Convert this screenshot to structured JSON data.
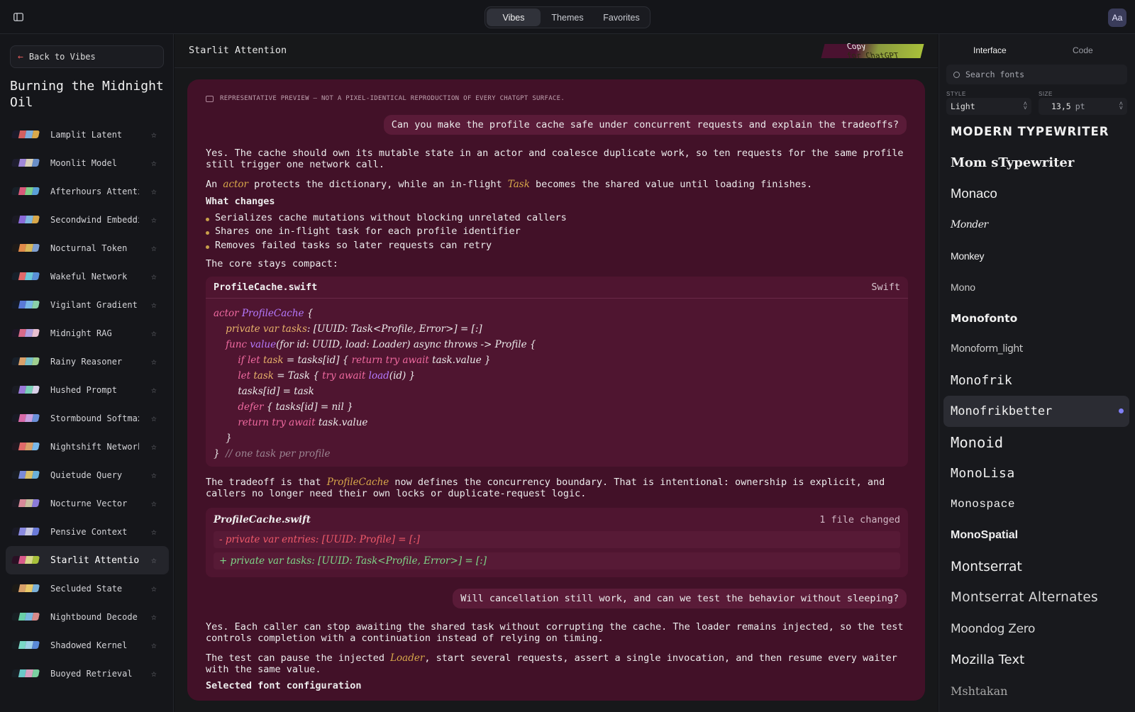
{
  "topbar": {
    "tabs": [
      {
        "label": "Vibes",
        "active": true
      },
      {
        "label": "Themes",
        "active": false
      },
      {
        "label": "Favorites",
        "active": false
      }
    ],
    "font_button": "Aa"
  },
  "left": {
    "back_label": "Back to Vibes",
    "title": "Burning the Midnight Oil",
    "vibes": [
      {
        "name": "Lamplit Latent",
        "colors": [
          "#1a1a2a",
          "#d46060",
          "#7faedc",
          "#d8a84a"
        ]
      },
      {
        "name": "Moonlit Model",
        "colors": [
          "#1e1d2e",
          "#a088d8",
          "#d8d0b8",
          "#6a8fc8"
        ]
      },
      {
        "name": "Afterhours Attenti…",
        "colors": [
          "#182028",
          "#d85a7a",
          "#7fd08a",
          "#5aa0d8"
        ]
      },
      {
        "name": "Secondwind Embeddi…",
        "colors": [
          "#1b1a24",
          "#8a6ad8",
          "#7fb8e0",
          "#d8a84a"
        ]
      },
      {
        "name": "Nocturnal Token",
        "colors": [
          "#1d1a18",
          "#e08a4a",
          "#d8b85a",
          "#7f9fd0"
        ]
      },
      {
        "name": "Wakeful Network",
        "colors": [
          "#16202a",
          "#e06a6a",
          "#6ac8d8",
          "#5a90d8"
        ]
      },
      {
        "name": "Vigilant Gradient",
        "colors": [
          "#141a26",
          "#5a7ad8",
          "#7ab8e8",
          "#8ad0a8"
        ]
      },
      {
        "name": "Midnight RAG",
        "colors": [
          "#1c1624",
          "#d86a8a",
          "#b0a0e0",
          "#e8c0d0"
        ]
      },
      {
        "name": "Rainy Reasoner",
        "colors": [
          "#18202a",
          "#d8a06a",
          "#7ac0c8",
          "#a0d090"
        ]
      },
      {
        "name": "Hushed Prompt",
        "colors": [
          "#1a1c24",
          "#9a7ad8",
          "#7ad0b8",
          "#d8d0e8"
        ]
      },
      {
        "name": "Stormbound Softmax",
        "colors": [
          "#181a24",
          "#d86aa8",
          "#c8a0e0",
          "#6a90d8"
        ]
      },
      {
        "name": "Nightshift Network",
        "colors": [
          "#201820",
          "#e06a6a",
          "#d8a06a",
          "#7ab8e8"
        ]
      },
      {
        "name": "Quietude Query",
        "colors": [
          "#181c22",
          "#7a8ad8",
          "#d8c06a",
          "#6ab0d8"
        ]
      },
      {
        "name": "Nocturne Vector",
        "colors": [
          "#1c1a22",
          "#d88a9a",
          "#c8c0a0",
          "#8a7ad8"
        ]
      },
      {
        "name": "Pensive Context",
        "colors": [
          "#1a1a26",
          "#8a8ae0",
          "#c8c8e0",
          "#6a7ad8"
        ]
      },
      {
        "name": "Starlit Attention",
        "colors": [
          "#2a1024",
          "#d85a8a",
          "#d8d88a",
          "#a8c03a"
        ],
        "selected": true
      },
      {
        "name": "Secluded State",
        "colors": [
          "#1c1a16",
          "#d8a06a",
          "#e8c86a",
          "#7ab0d8"
        ]
      },
      {
        "name": "Nightbound Decoder",
        "colors": [
          "#181e22",
          "#6ad0a8",
          "#7ab8e0",
          "#d88a8a"
        ]
      },
      {
        "name": "Shadowed Kernel",
        "colors": [
          "#161c20",
          "#7ad8c8",
          "#a0d0e8",
          "#5a8ad8"
        ]
      },
      {
        "name": "Buoyed Retrieval",
        "colors": [
          "#181e24",
          "#6ac8c8",
          "#d8a0c0",
          "#7ad0a0"
        ]
      }
    ]
  },
  "main": {
    "title": "Starlit Attention",
    "copy_label_a": "Copy ",
    "copy_label_b": "for ChatGPT",
    "note": "REPRESENTATIVE PREVIEW — NOT A PIXEL-IDENTICAL REPRODUCTION OF EVERY CHATGPT SURFACE.",
    "user_q1": "Can you make the profile cache safe under concurrent requests and explain the tradeoffs?",
    "a1": "Yes. The cache should own its mutable state in an actor and coalesce duplicate work, so ten requests for the same profile still trigger one network call.",
    "a2_pre": "An ",
    "a2_actor": "actor",
    "a2_mid": " protects the dictionary, while an in-flight ",
    "a2_task": "Task",
    "a2_post": " becomes the shared value until loading finishes.",
    "heading": "What changes",
    "bullets": [
      "Serializes cache mutations without blocking unrelated callers",
      "Shares one in-flight task for each profile identifier",
      "Removes failed tasks so later requests can retry"
    ],
    "core": "The core stays compact:",
    "code_file": "ProfileCache.swift",
    "code_lang": "Swift",
    "tradeoff_pre": "The tradeoff is that ",
    "tradeoff_hl": "ProfileCache",
    "tradeoff_post": " now defines the concurrency boundary. That is intentional: ownership is explicit, and callers no longer need their own locks or duplicate-request logic.",
    "diff_file": "ProfileCache.swift",
    "diff_count": "1 file changed",
    "diff_removed": "- private var entries: [UUID: Profile] = [:]",
    "diff_added": "+ private var tasks: [UUID: Task<Profile, Error>] = [:]",
    "user_q2": "Will cancellation still work, and can we test the behavior without sleeping?",
    "a3": "Yes. Each caller can stop awaiting the shared task without corrupting the cache. The loader remains injected, so the test controls completion with a continuation instead of relying on timing.",
    "a4_pre": "The test can pause the injected ",
    "a4_hl": "Loader",
    "a4_post": ", start several requests, assert a single invocation, and then resume every waiter with the same value.",
    "trailing": "Selected font configuration"
  },
  "right": {
    "tabs": [
      "Interface",
      "Code"
    ],
    "search_placeholder": "Search fonts",
    "style_label": "STYLE",
    "style_value": "Light",
    "size_label": "SIZE",
    "size_value": "13,5",
    "size_unit": "pt",
    "fonts": [
      {
        "name": "MODERN TYPEWRITER"
      },
      {
        "name": "Mom sTypewriter"
      },
      {
        "name": "Monaco"
      },
      {
        "name": "Monder"
      },
      {
        "name": "Monkey"
      },
      {
        "name": "Mono"
      },
      {
        "name": "Monofonto"
      },
      {
        "name": "Monoform_light"
      },
      {
        "name": "Monofrik"
      },
      {
        "name": "Monofrikbetter",
        "selected": true
      },
      {
        "name": "Monoid"
      },
      {
        "name": "MonoLisa"
      },
      {
        "name": "Monospace"
      },
      {
        "name": "MonoSpatial"
      },
      {
        "name": "Montserrat"
      },
      {
        "name": "Montserrat Alternates"
      },
      {
        "name": "Moondog Zero"
      },
      {
        "name": "Mozilla Text"
      },
      {
        "name": "Mshtakan"
      }
    ]
  }
}
